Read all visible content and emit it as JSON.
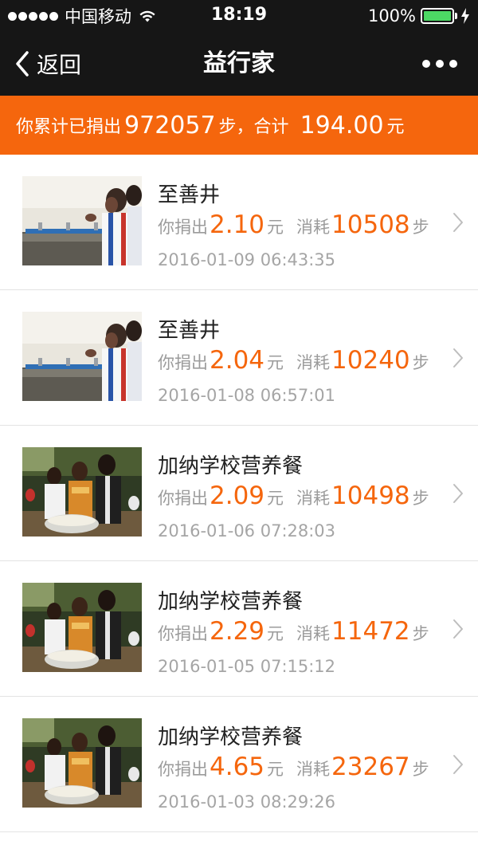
{
  "status_bar": {
    "carrier": "中国移动",
    "time": "18:19",
    "battery": "100%",
    "icons": [
      "signal-dots",
      "wifi-icon",
      "battery-icon",
      "charging-bolt-icon"
    ]
  },
  "nav": {
    "back_label": "返回",
    "title": "益行家",
    "icons": [
      "back-chevron-icon",
      "more-icon"
    ]
  },
  "summary": {
    "prefix": "你累计已捐出",
    "steps": "972057",
    "steps_unit": "步，合计",
    "amount": "194.00",
    "amount_unit": "元"
  },
  "colors": {
    "accent": "#f5660d",
    "nav_bg": "#161616",
    "muted": "#9b9b9b"
  },
  "labels": {
    "donated": "你捐出",
    "yuan": "元",
    "consumed": "消耗",
    "steps": "步"
  },
  "items": [
    {
      "title": "至善井",
      "amount": "2.10",
      "steps": "10508",
      "date": "2016-01-09 06:43:35",
      "image": "well-photo"
    },
    {
      "title": "至善井",
      "amount": "2.04",
      "steps": "10240",
      "date": "2016-01-08 06:57:01",
      "image": "well-photo"
    },
    {
      "title": "加纳学校营养餐",
      "amount": "2.09",
      "steps": "10498",
      "date": "2016-01-06 07:28:03",
      "image": "school-meal-photo"
    },
    {
      "title": "加纳学校营养餐",
      "amount": "2.29",
      "steps": "11472",
      "date": "2016-01-05 07:15:12",
      "image": "school-meal-photo"
    },
    {
      "title": "加纳学校营养餐",
      "amount": "4.65",
      "steps": "23267",
      "date": "2016-01-03 08:29:26",
      "image": "school-meal-photo"
    }
  ]
}
